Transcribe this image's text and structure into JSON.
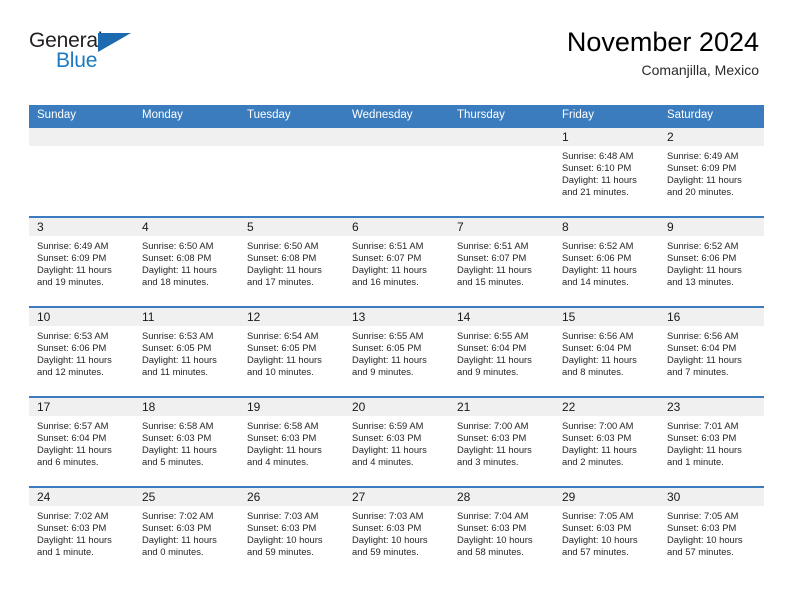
{
  "logo": {
    "word_top": "General",
    "word_bottom": "Blue",
    "triangle_icon": "blue-triangle-icon",
    "accent_color": "#1c7ac0"
  },
  "header": {
    "title": "November 2024",
    "location": "Comanjilla, Mexico"
  },
  "theme": {
    "header_blue": "#3a7cbe",
    "daynum_strip": "#f0f0f0",
    "text": "#262626"
  },
  "calendar": {
    "weekdays": [
      "Sunday",
      "Monday",
      "Tuesday",
      "Wednesday",
      "Thursday",
      "Friday",
      "Saturday"
    ],
    "weeks": [
      [
        {
          "day": ""
        },
        {
          "day": ""
        },
        {
          "day": ""
        },
        {
          "day": ""
        },
        {
          "day": ""
        },
        {
          "day": "1",
          "sunrise": "Sunrise: 6:48 AM",
          "sunset": "Sunset: 6:10 PM",
          "daylight_1": "Daylight: 11 hours",
          "daylight_2": "and 21 minutes."
        },
        {
          "day": "2",
          "sunrise": "Sunrise: 6:49 AM",
          "sunset": "Sunset: 6:09 PM",
          "daylight_1": "Daylight: 11 hours",
          "daylight_2": "and 20 minutes."
        }
      ],
      [
        {
          "day": "3",
          "sunrise": "Sunrise: 6:49 AM",
          "sunset": "Sunset: 6:09 PM",
          "daylight_1": "Daylight: 11 hours",
          "daylight_2": "and 19 minutes."
        },
        {
          "day": "4",
          "sunrise": "Sunrise: 6:50 AM",
          "sunset": "Sunset: 6:08 PM",
          "daylight_1": "Daylight: 11 hours",
          "daylight_2": "and 18 minutes."
        },
        {
          "day": "5",
          "sunrise": "Sunrise: 6:50 AM",
          "sunset": "Sunset: 6:08 PM",
          "daylight_1": "Daylight: 11 hours",
          "daylight_2": "and 17 minutes."
        },
        {
          "day": "6",
          "sunrise": "Sunrise: 6:51 AM",
          "sunset": "Sunset: 6:07 PM",
          "daylight_1": "Daylight: 11 hours",
          "daylight_2": "and 16 minutes."
        },
        {
          "day": "7",
          "sunrise": "Sunrise: 6:51 AM",
          "sunset": "Sunset: 6:07 PM",
          "daylight_1": "Daylight: 11 hours",
          "daylight_2": "and 15 minutes."
        },
        {
          "day": "8",
          "sunrise": "Sunrise: 6:52 AM",
          "sunset": "Sunset: 6:06 PM",
          "daylight_1": "Daylight: 11 hours",
          "daylight_2": "and 14 minutes."
        },
        {
          "day": "9",
          "sunrise": "Sunrise: 6:52 AM",
          "sunset": "Sunset: 6:06 PM",
          "daylight_1": "Daylight: 11 hours",
          "daylight_2": "and 13 minutes."
        }
      ],
      [
        {
          "day": "10",
          "sunrise": "Sunrise: 6:53 AM",
          "sunset": "Sunset: 6:06 PM",
          "daylight_1": "Daylight: 11 hours",
          "daylight_2": "and 12 minutes."
        },
        {
          "day": "11",
          "sunrise": "Sunrise: 6:53 AM",
          "sunset": "Sunset: 6:05 PM",
          "daylight_1": "Daylight: 11 hours",
          "daylight_2": "and 11 minutes."
        },
        {
          "day": "12",
          "sunrise": "Sunrise: 6:54 AM",
          "sunset": "Sunset: 6:05 PM",
          "daylight_1": "Daylight: 11 hours",
          "daylight_2": "and 10 minutes."
        },
        {
          "day": "13",
          "sunrise": "Sunrise: 6:55 AM",
          "sunset": "Sunset: 6:05 PM",
          "daylight_1": "Daylight: 11 hours",
          "daylight_2": "and 9 minutes."
        },
        {
          "day": "14",
          "sunrise": "Sunrise: 6:55 AM",
          "sunset": "Sunset: 6:04 PM",
          "daylight_1": "Daylight: 11 hours",
          "daylight_2": "and 9 minutes."
        },
        {
          "day": "15",
          "sunrise": "Sunrise: 6:56 AM",
          "sunset": "Sunset: 6:04 PM",
          "daylight_1": "Daylight: 11 hours",
          "daylight_2": "and 8 minutes."
        },
        {
          "day": "16",
          "sunrise": "Sunrise: 6:56 AM",
          "sunset": "Sunset: 6:04 PM",
          "daylight_1": "Daylight: 11 hours",
          "daylight_2": "and 7 minutes."
        }
      ],
      [
        {
          "day": "17",
          "sunrise": "Sunrise: 6:57 AM",
          "sunset": "Sunset: 6:04 PM",
          "daylight_1": "Daylight: 11 hours",
          "daylight_2": "and 6 minutes."
        },
        {
          "day": "18",
          "sunrise": "Sunrise: 6:58 AM",
          "sunset": "Sunset: 6:03 PM",
          "daylight_1": "Daylight: 11 hours",
          "daylight_2": "and 5 minutes."
        },
        {
          "day": "19",
          "sunrise": "Sunrise: 6:58 AM",
          "sunset": "Sunset: 6:03 PM",
          "daylight_1": "Daylight: 11 hours",
          "daylight_2": "and 4 minutes."
        },
        {
          "day": "20",
          "sunrise": "Sunrise: 6:59 AM",
          "sunset": "Sunset: 6:03 PM",
          "daylight_1": "Daylight: 11 hours",
          "daylight_2": "and 4 minutes."
        },
        {
          "day": "21",
          "sunrise": "Sunrise: 7:00 AM",
          "sunset": "Sunset: 6:03 PM",
          "daylight_1": "Daylight: 11 hours",
          "daylight_2": "and 3 minutes."
        },
        {
          "day": "22",
          "sunrise": "Sunrise: 7:00 AM",
          "sunset": "Sunset: 6:03 PM",
          "daylight_1": "Daylight: 11 hours",
          "daylight_2": "and 2 minutes."
        },
        {
          "day": "23",
          "sunrise": "Sunrise: 7:01 AM",
          "sunset": "Sunset: 6:03 PM",
          "daylight_1": "Daylight: 11 hours",
          "daylight_2": "and 1 minute."
        }
      ],
      [
        {
          "day": "24",
          "sunrise": "Sunrise: 7:02 AM",
          "sunset": "Sunset: 6:03 PM",
          "daylight_1": "Daylight: 11 hours",
          "daylight_2": "and 1 minute."
        },
        {
          "day": "25",
          "sunrise": "Sunrise: 7:02 AM",
          "sunset": "Sunset: 6:03 PM",
          "daylight_1": "Daylight: 11 hours",
          "daylight_2": "and 0 minutes."
        },
        {
          "day": "26",
          "sunrise": "Sunrise: 7:03 AM",
          "sunset": "Sunset: 6:03 PM",
          "daylight_1": "Daylight: 10 hours",
          "daylight_2": "and 59 minutes."
        },
        {
          "day": "27",
          "sunrise": "Sunrise: 7:03 AM",
          "sunset": "Sunset: 6:03 PM",
          "daylight_1": "Daylight: 10 hours",
          "daylight_2": "and 59 minutes."
        },
        {
          "day": "28",
          "sunrise": "Sunrise: 7:04 AM",
          "sunset": "Sunset: 6:03 PM",
          "daylight_1": "Daylight: 10 hours",
          "daylight_2": "and 58 minutes."
        },
        {
          "day": "29",
          "sunrise": "Sunrise: 7:05 AM",
          "sunset": "Sunset: 6:03 PM",
          "daylight_1": "Daylight: 10 hours",
          "daylight_2": "and 57 minutes."
        },
        {
          "day": "30",
          "sunrise": "Sunrise: 7:05 AM",
          "sunset": "Sunset: 6:03 PM",
          "daylight_1": "Daylight: 10 hours",
          "daylight_2": "and 57 minutes."
        }
      ]
    ]
  }
}
